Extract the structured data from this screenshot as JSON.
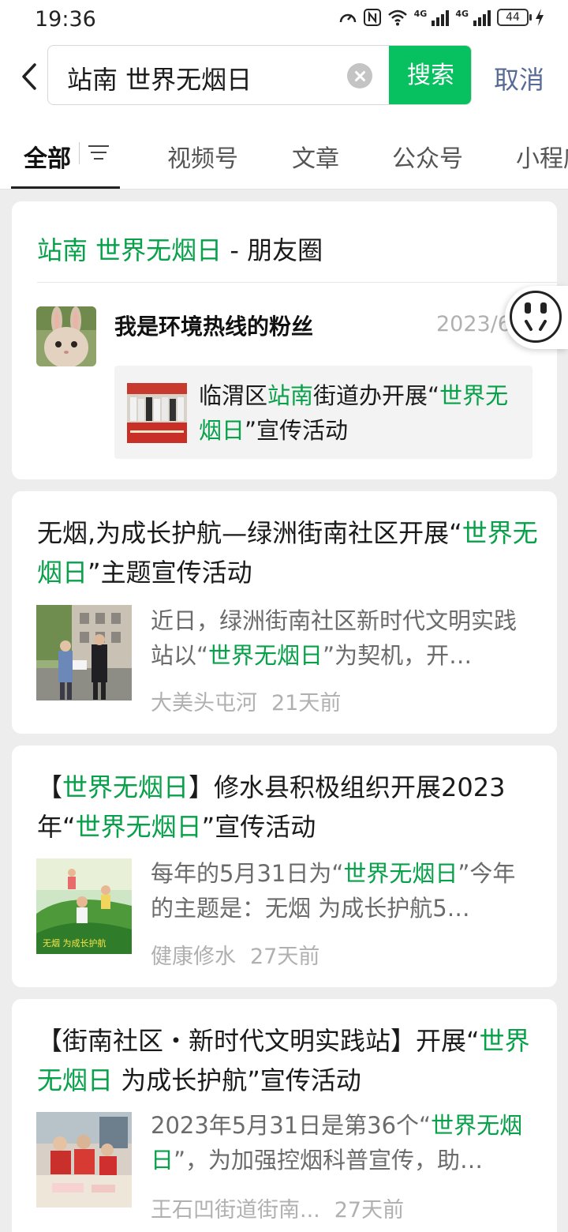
{
  "status_bar": {
    "time": "19:36",
    "battery": "44",
    "net1": "4G",
    "net2": "4G"
  },
  "search": {
    "query": "站南 世界无烟日",
    "button_label": "搜索",
    "cancel_label": "取消"
  },
  "tabs": [
    {
      "label": "全部",
      "active": true
    },
    {
      "label": "视频号"
    },
    {
      "label": "文章"
    },
    {
      "label": "公众号"
    },
    {
      "label": "小程序"
    }
  ],
  "moments_card": {
    "title_highlight": "站南 世界无烟日",
    "title_suffix": " - 朋友圈",
    "poster_name": "我是环境热线的粉丝",
    "date": "2023/6",
    "shared": {
      "p1": "临渭区",
      "h1": "站南",
      "p2": "街道办开展“",
      "h2": "世界无烟日",
      "p3": "”宣传活动"
    }
  },
  "articles": [
    {
      "title": {
        "t1": "无烟,为成长护航—绿洲街南社区开展“",
        "h1": "世界无烟日",
        "t2": "”主题宣传活动"
      },
      "desc": {
        "d1": "近日，绿洲街南社区新时代文明实践站以“",
        "h1": "世界无烟日",
        "d2": "”为契机，开…"
      },
      "source": "大美头屯河",
      "time": "21天前"
    },
    {
      "title": {
        "t0": "【",
        "h0": "世界无烟日",
        "t1": "】修水县积极组织开展2023年“",
        "h1": "世界无烟日",
        "t2": "”宣传活动"
      },
      "desc": {
        "d1": "每年的5月31日为“",
        "h1": "世界无烟日",
        "d2": "”今年的主题是：无烟 为成长护航5…"
      },
      "source": "健康修水",
      "time": "27天前"
    },
    {
      "title": {
        "t1": "【街南社区・新时代文明实践站】开展“",
        "h1": "世界无烟日",
        "t2": " 为成长护航”宣传活动"
      },
      "desc": {
        "d1": "2023年5月31日是第36个“",
        "h1": "世界无烟日",
        "d2": "”，为加强控烟科普宣传，助…"
      },
      "source": "王石凹街道街南...",
      "time": "27天前"
    }
  ],
  "colors": {
    "highlight": "#07a14a",
    "search_button": "#07c160",
    "cancel": "#576b95"
  }
}
